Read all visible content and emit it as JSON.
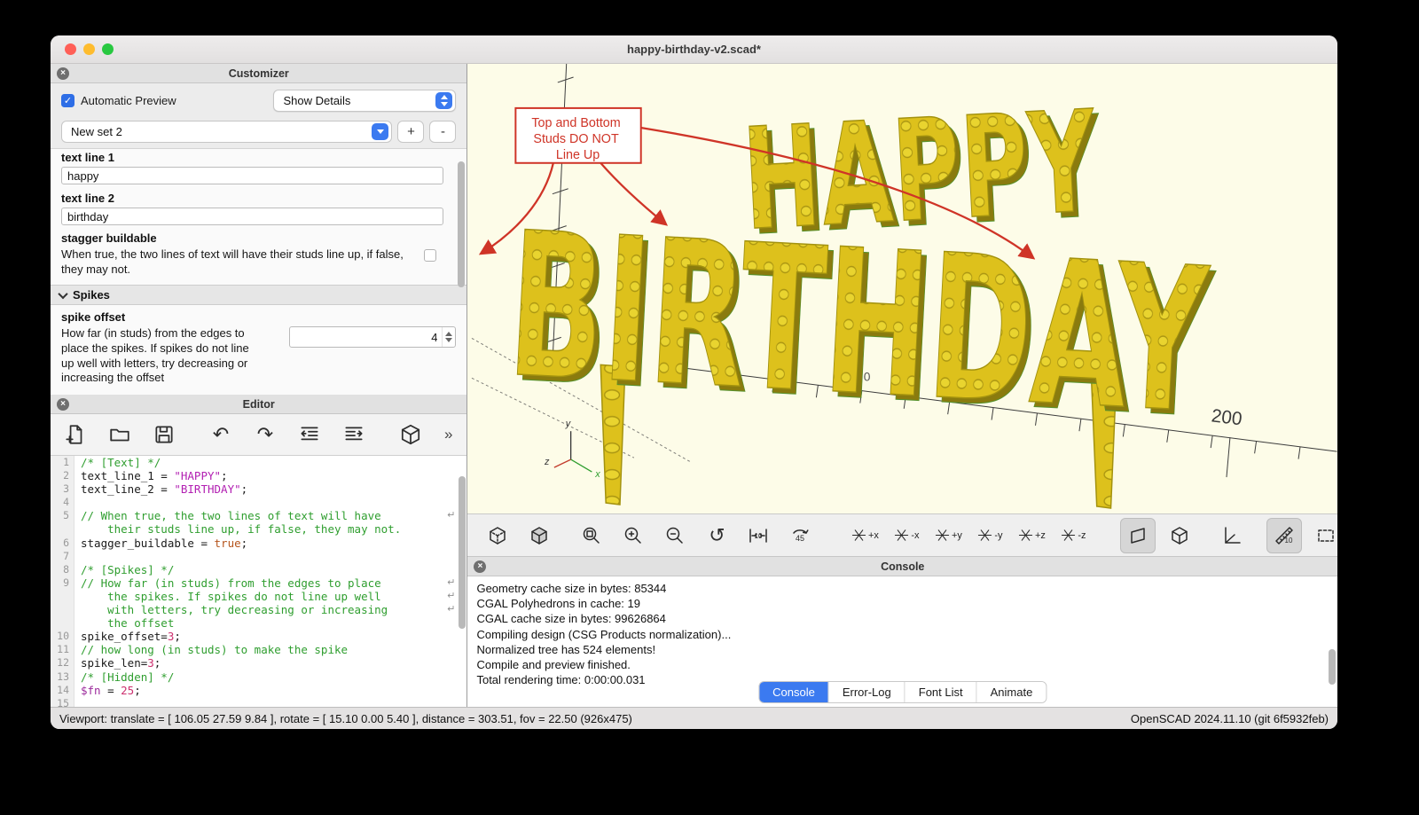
{
  "colors": {
    "accent_blue": "#3b7af0",
    "annotation_red": "#cf3427",
    "brick_yellow": "#ddc11c",
    "viewport_bg": "#fdfce8",
    "comment_green": "#2f9e2f",
    "string_purple": "#b21fb2"
  },
  "window": {
    "title": "happy-birthday-v2.scad*"
  },
  "customizer": {
    "header": "Customizer",
    "automatic_preview_label": "Automatic Preview",
    "automatic_preview_checked": true,
    "details_dropdown_value": "Show Details",
    "preset_value": "New set 2",
    "add_label": "+",
    "remove_label": "-",
    "text_line_1_label": "text line 1",
    "text_line_1_value": "happy",
    "text_line_2_label": "text line 2",
    "text_line_2_value": "birthday",
    "stagger_label": "stagger buildable",
    "stagger_desc": "When true, the two lines of text will have their studs line up, if false, they may not.",
    "stagger_checked": false,
    "spikes_header": "Spikes",
    "spike_offset_label": "spike offset",
    "spike_offset_desc": "How far (in studs) from the edges to place the spikes. If spikes do not line up well with letters, try decreasing or increasing the offset",
    "spike_offset_value": "4"
  },
  "editor": {
    "header": "Editor",
    "more_label": "»",
    "code_rows": [
      {
        "num": "1",
        "segs": [
          {
            "t": "/* [Text] */",
            "c": "com"
          }
        ]
      },
      {
        "num": "2",
        "segs": [
          {
            "t": "text_line_1 = ",
            "c": "pln"
          },
          {
            "t": "\"HAPPY\"",
            "c": "str"
          },
          {
            "t": ";",
            "c": "pln"
          }
        ]
      },
      {
        "num": "3",
        "segs": [
          {
            "t": "text_line_2 = ",
            "c": "pln"
          },
          {
            "t": "\"BIRTHDAY\"",
            "c": "str"
          },
          {
            "t": ";",
            "c": "pln"
          }
        ]
      },
      {
        "num": "4",
        "segs": []
      },
      {
        "num": "5",
        "segs": [
          {
            "t": "// When true, the two lines of text will have",
            "c": "com"
          }
        ],
        "wrap": true
      },
      {
        "num": "",
        "segs": [
          {
            "t": "    their studs line up, if false, they may not.",
            "c": "com"
          }
        ]
      },
      {
        "num": "6",
        "segs": [
          {
            "t": "stagger_buildable = ",
            "c": "pln"
          },
          {
            "t": "true",
            "c": "kw"
          },
          {
            "t": ";",
            "c": "pln"
          }
        ]
      },
      {
        "num": "7",
        "segs": []
      },
      {
        "num": "8",
        "segs": [
          {
            "t": "/* [Spikes] */",
            "c": "com"
          }
        ]
      },
      {
        "num": "9",
        "segs": [
          {
            "t": "// How far (in studs) from the edges to place",
            "c": "com"
          }
        ],
        "wrap": true
      },
      {
        "num": "",
        "segs": [
          {
            "t": "    the spikes. If spikes do not line up well",
            "c": "com"
          }
        ],
        "wrap": true
      },
      {
        "num": "",
        "segs": [
          {
            "t": "    with letters, try decreasing or increasing",
            "c": "com"
          }
        ],
        "wrap": true
      },
      {
        "num": "",
        "segs": [
          {
            "t": "    the offset",
            "c": "com"
          }
        ]
      },
      {
        "num": "10",
        "segs": [
          {
            "t": "spike_offset=",
            "c": "pln"
          },
          {
            "t": "3",
            "c": "num"
          },
          {
            "t": ";",
            "c": "pln"
          }
        ]
      },
      {
        "num": "11",
        "segs": [
          {
            "t": "// how long (in studs) to make the spike",
            "c": "com"
          }
        ]
      },
      {
        "num": "12",
        "segs": [
          {
            "t": "spike_len=",
            "c": "pln"
          },
          {
            "t": "3",
            "c": "num"
          },
          {
            "t": ";",
            "c": "pln"
          }
        ]
      },
      {
        "num": "13",
        "segs": [
          {
            "t": "/* [Hidden] */",
            "c": "com"
          }
        ]
      },
      {
        "num": "14",
        "segs": [
          {
            "t": "$fn",
            "c": "var"
          },
          {
            "t": " = ",
            "c": "pln"
          },
          {
            "t": "25",
            "c": "num"
          },
          {
            "t": ";",
            "c": "pln"
          }
        ]
      },
      {
        "num": "15",
        "segs": []
      }
    ]
  },
  "viewport": {
    "word_top": "HAPPY",
    "word_bottom": "BIRTHDAY",
    "annotation_line1": "Top and Bottom",
    "annotation_line2": "Studs DO NOT",
    "annotation_line3": "Line Up",
    "axis_label_200": "200",
    "axis_label_0": "0",
    "gizmo_x": "x",
    "gizmo_y": "y",
    "gizmo_z": "z"
  },
  "view_toolbar": {
    "distance_label": "10",
    "rotate_label": "45",
    "ruler_label": "10",
    "axis_labels": [
      "+x",
      "-x",
      "+y",
      "-y",
      "+z",
      "-z"
    ]
  },
  "console": {
    "header": "Console",
    "lines": [
      "Geometry cache size in bytes: 85344",
      "CGAL Polyhedrons in cache: 19",
      "CGAL cache size in bytes: 99626864",
      "Compiling design (CSG Products normalization)...",
      "Normalized tree has 524 elements!",
      "Compile and preview finished.",
      "Total rendering time: 0:00:00.031"
    ],
    "tabs": [
      {
        "label": "Console",
        "active": true
      },
      {
        "label": "Error-Log",
        "active": false
      },
      {
        "label": "Font List",
        "active": false
      },
      {
        "label": "Animate",
        "active": false
      }
    ]
  },
  "statusbar": {
    "left": "Viewport: translate = [ 106.05 27.59 9.84 ], rotate = [ 15.10 0.00 5.40 ], distance = 303.51, fov = 22.50 (926x475)",
    "right": "OpenSCAD 2024.11.10 (git 6f5932feb)"
  }
}
